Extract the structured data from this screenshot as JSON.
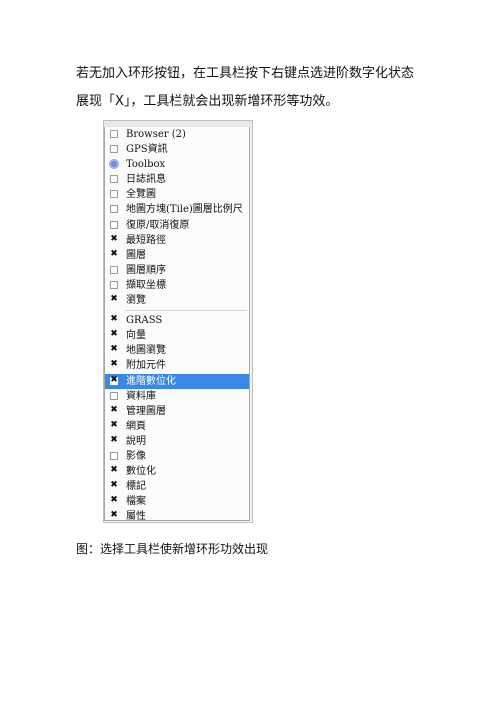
{
  "paragraph": {
    "line1": "若无加入环形按钮，在工具栏按下右键点选进阶数字化状态",
    "line2": "展现「X」，工具栏就会出现新增环形等功效。"
  },
  "menu": {
    "items": [
      {
        "label": "Browser (2)",
        "state": "unchecked",
        "icon": "checkbox"
      },
      {
        "label": "GPS資訊",
        "state": "unchecked",
        "icon": "checkbox"
      },
      {
        "label": "Toolbox",
        "state": "none",
        "icon": "gear-icon"
      },
      {
        "label": "日誌訊息",
        "state": "unchecked",
        "icon": "checkbox"
      },
      {
        "label": "全覽圖",
        "state": "unchecked",
        "icon": "checkbox"
      },
      {
        "label": "地圖方塊(Tile)圖層比例尺",
        "state": "unchecked",
        "icon": "checkbox"
      },
      {
        "label": "復原/取消復原",
        "state": "unchecked",
        "icon": "checkbox"
      },
      {
        "label": "最短路徑",
        "state": "checked",
        "icon": "checkbox"
      },
      {
        "label": "圖層",
        "state": "checked",
        "icon": "checkbox"
      },
      {
        "label": "圖層順序",
        "state": "unchecked",
        "icon": "checkbox"
      },
      {
        "label": "擷取坐標",
        "state": "unchecked",
        "icon": "checkbox"
      },
      {
        "label": "瀏覽",
        "state": "checked",
        "icon": "checkbox"
      },
      {
        "label": "GRASS",
        "state": "checked",
        "icon": "checkbox"
      },
      {
        "label": "向量",
        "state": "checked",
        "icon": "checkbox"
      },
      {
        "label": "地圖瀏覽",
        "state": "checked",
        "icon": "checkbox"
      },
      {
        "label": "附加元件",
        "state": "checked",
        "icon": "checkbox"
      },
      {
        "label": "進階數位化",
        "state": "checked",
        "icon": "checkbox",
        "highlighted": true
      },
      {
        "label": "資料庫",
        "state": "unchecked",
        "icon": "checkbox"
      },
      {
        "label": "管理圖層",
        "state": "checked",
        "icon": "checkbox"
      },
      {
        "label": "網頁",
        "state": "checked",
        "icon": "checkbox"
      },
      {
        "label": "說明",
        "state": "checked",
        "icon": "checkbox"
      },
      {
        "label": "影像",
        "state": "unchecked",
        "icon": "checkbox"
      },
      {
        "label": "數位化",
        "state": "checked",
        "icon": "checkbox"
      },
      {
        "label": "標記",
        "state": "checked",
        "icon": "checkbox"
      },
      {
        "label": "檔案",
        "state": "checked",
        "icon": "checkbox"
      },
      {
        "label": "屬性",
        "state": "checked",
        "icon": "checkbox"
      }
    ],
    "check_glyph": "✖",
    "highlight_color": "#3a88e6"
  },
  "caption": "图：选择工具栏使新增环形功效出现"
}
